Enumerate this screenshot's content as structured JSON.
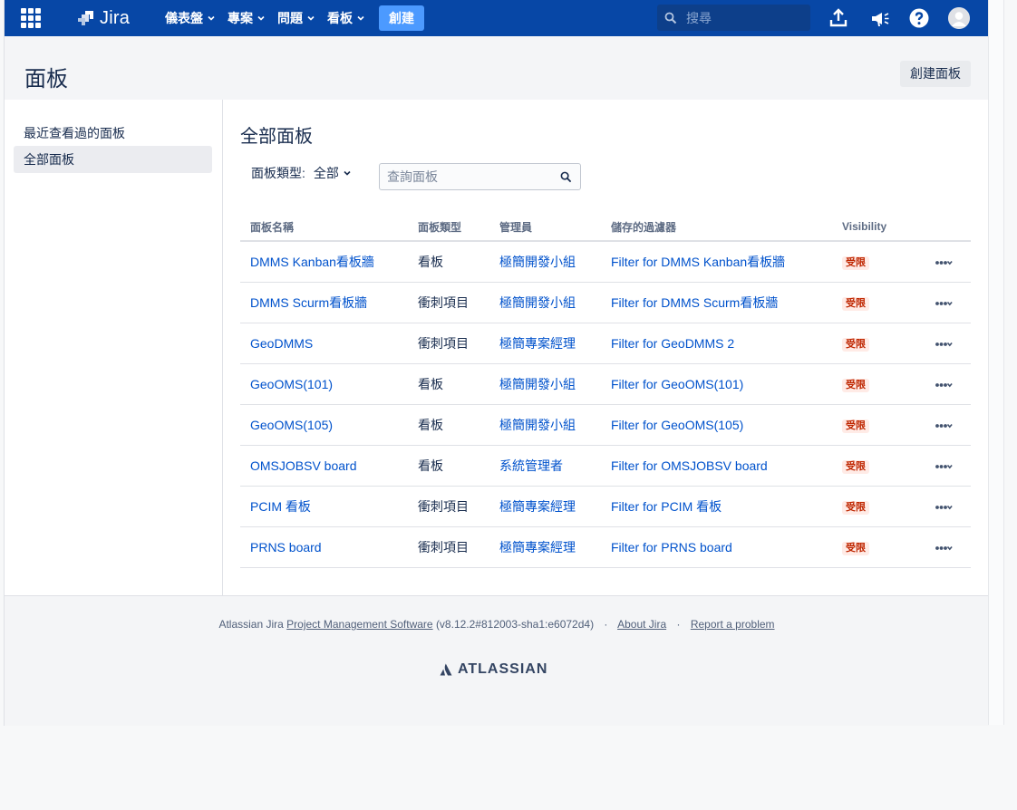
{
  "header": {
    "app_name": "Jira",
    "nav": [
      {
        "label": "儀表盤"
      },
      {
        "label": "專案"
      },
      {
        "label": "問題"
      },
      {
        "label": "看板"
      }
    ],
    "create_label": "創建",
    "search_placeholder": "搜尋",
    "brand_color": "#0747a6"
  },
  "page": {
    "title": "面板",
    "create_board_label": "創建面板"
  },
  "sidebar": {
    "items": [
      {
        "label": "最近查看過的面板"
      },
      {
        "label": "全部面板",
        "active": true
      }
    ]
  },
  "main": {
    "title": "全部面板",
    "filter_label": "面板類型:",
    "filter_value": "全部",
    "query_placeholder": "查詢面板",
    "columns": [
      "面板名稱",
      "面板類型",
      "管理員",
      "儲存的過濾器",
      "Visibility"
    ],
    "rows": [
      {
        "name": "DMMS Kanban看板牆",
        "type": "看板",
        "admin": "極簡開發小組",
        "filter": "Filter for DMMS Kanban看板牆",
        "visibility": "受限"
      },
      {
        "name": "DMMS Scurm看板牆",
        "type": "衝刺項目",
        "admin": "極簡開發小組",
        "filter": "Filter for DMMS Scurm看板牆",
        "visibility": "受限"
      },
      {
        "name": "GeoDMMS",
        "type": "衝刺項目",
        "admin": "極簡專案經理",
        "filter": "Filter for GeoDMMS 2",
        "visibility": "受限"
      },
      {
        "name": "GeoOMS(101)",
        "type": "看板",
        "admin": "極簡開發小組",
        "filter": "Filter for GeoOMS(101)",
        "visibility": "受限"
      },
      {
        "name": "GeoOMS(105)",
        "type": "看板",
        "admin": "極簡開發小組",
        "filter": "Filter for GeoOMS(105)",
        "visibility": "受限"
      },
      {
        "name": "OMSJOBSV board",
        "type": "看板",
        "admin": "系統管理者",
        "filter": "Filter for OMSJOBSV board",
        "visibility": "受限"
      },
      {
        "name": "PCIM 看板",
        "type": "衝刺項目",
        "admin": "極簡專案經理",
        "filter": "Filter for PCIM 看板",
        "visibility": "受限"
      },
      {
        "name": "PRNS board",
        "type": "衝刺項目",
        "admin": "極簡專案經理",
        "filter": "Filter for PRNS board",
        "visibility": "受限"
      }
    ]
  },
  "footer": {
    "prefix": "Atlassian Jira",
    "product_link": "Project Management Software",
    "version": "(v8.12.2#812003-sha1:e6072d4)",
    "sep": "·",
    "about_link": "About Jira",
    "report_link": "Report a problem",
    "brand": "ATLASSIAN"
  }
}
